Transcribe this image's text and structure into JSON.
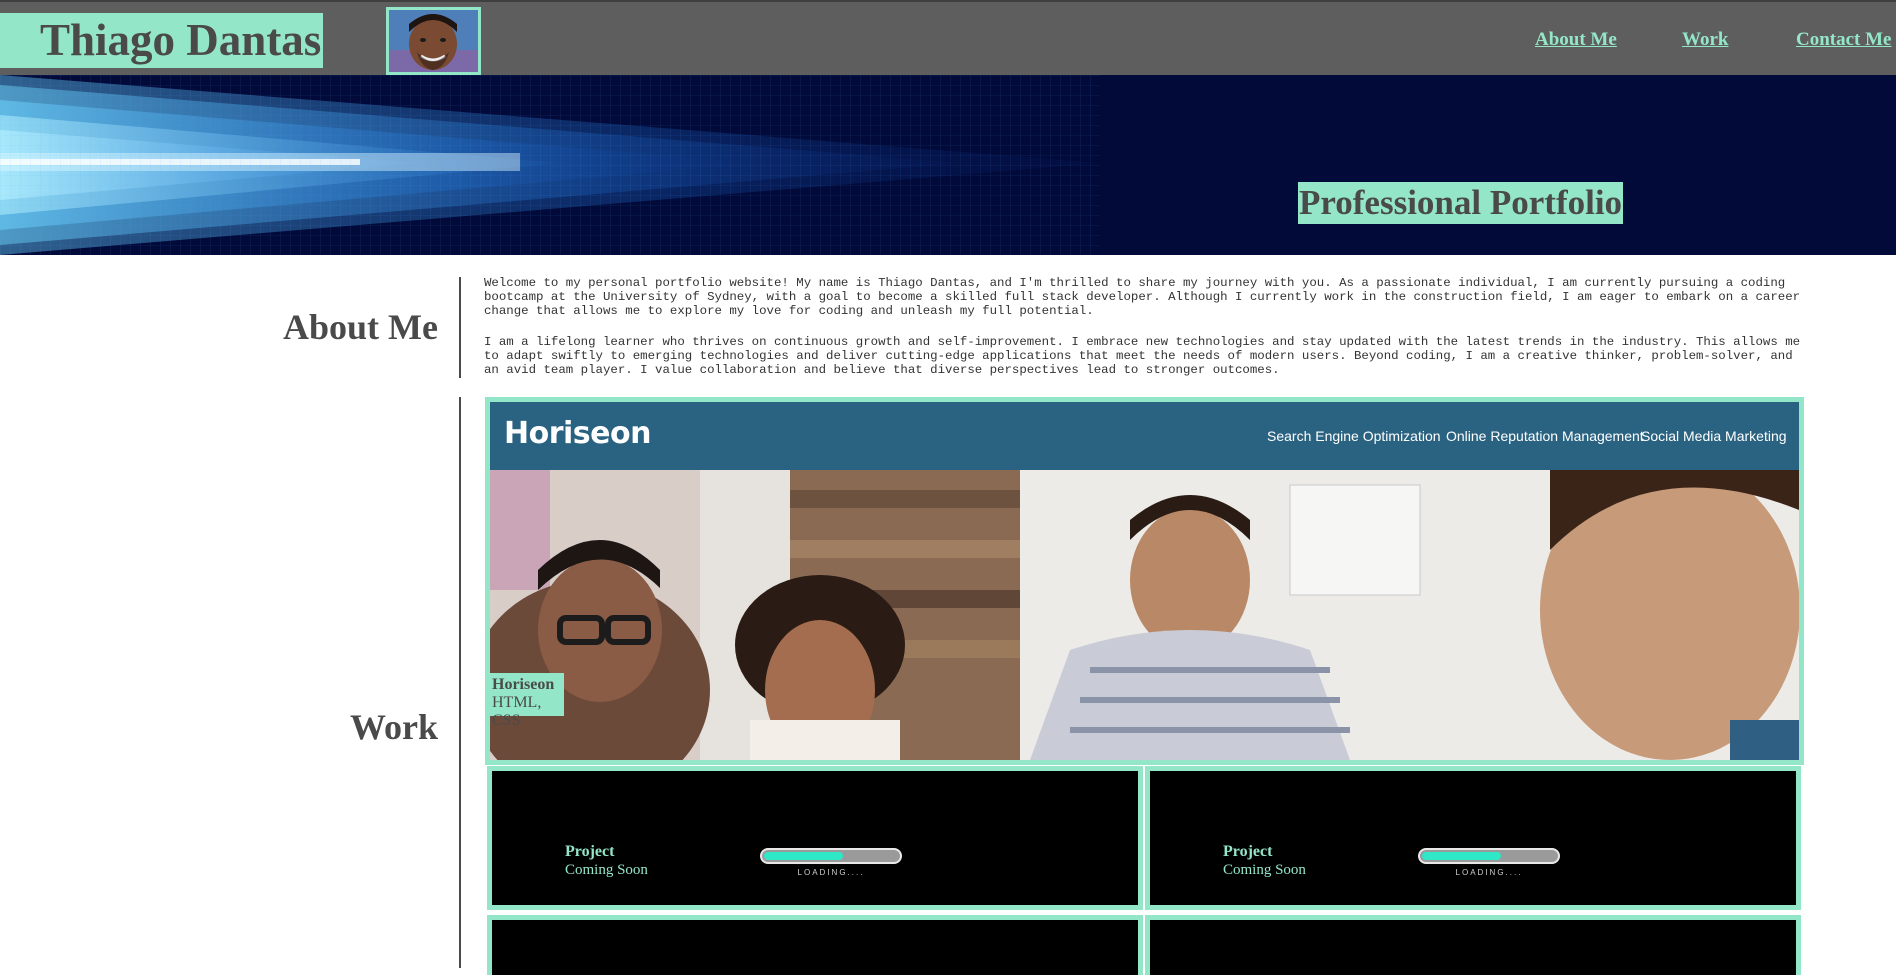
{
  "header": {
    "name": "Thiago Dantas",
    "nav": [
      "About Me",
      "Work",
      "Contact Me"
    ]
  },
  "hero": {
    "title": "Professional Portfolio"
  },
  "about": {
    "heading": "About Me",
    "paragraphs": [
      "Welcome to my personal portfolio website! My name is Thiago Dantas, and I'm thrilled to share my journey with you. As a passionate individual, I am currently pursuing a coding bootcamp at the University of Sydney, with a goal to become a skilled full stack developer. Although I currently work in the construction field, I am eager to embark on a career change that allows me to explore my love for coding and unleash my full potential.",
      "I am a lifelong learner who thrives on continuous growth and self-improvement. I embrace new technologies and stay updated with the latest trends in the industry. This allows me to adapt swiftly to emerging technologies and deliver cutting-edge applications that meet the needs of modern users. Beyond coding, I am a creative thinker, problem-solver, and an avid team player. I value collaboration and believe that diverse perspectives lead to stronger outcomes."
    ]
  },
  "work": {
    "heading": "Work",
    "featured": {
      "site_logo": "Horiseon",
      "site_nav": [
        "Search Engine Optimization",
        "Online Reputation Management",
        "Social Media Marketing"
      ],
      "title": "Horiseon",
      "tech": "HTML, CSS"
    },
    "placeholders": [
      {
        "title": "Project",
        "subtitle": "Coming Soon",
        "loading": "LOADING....",
        "progress": 0.6
      },
      {
        "title": "Project",
        "subtitle": "Coming Soon",
        "loading": "LOADING....",
        "progress": 0.6
      }
    ]
  },
  "colors": {
    "accent": "#94e6c9",
    "header_bg": "#5f5e5e",
    "text": "#4a4a4a",
    "hero_bg": "#020a3a",
    "loader_fill": "#2fe8c8"
  }
}
